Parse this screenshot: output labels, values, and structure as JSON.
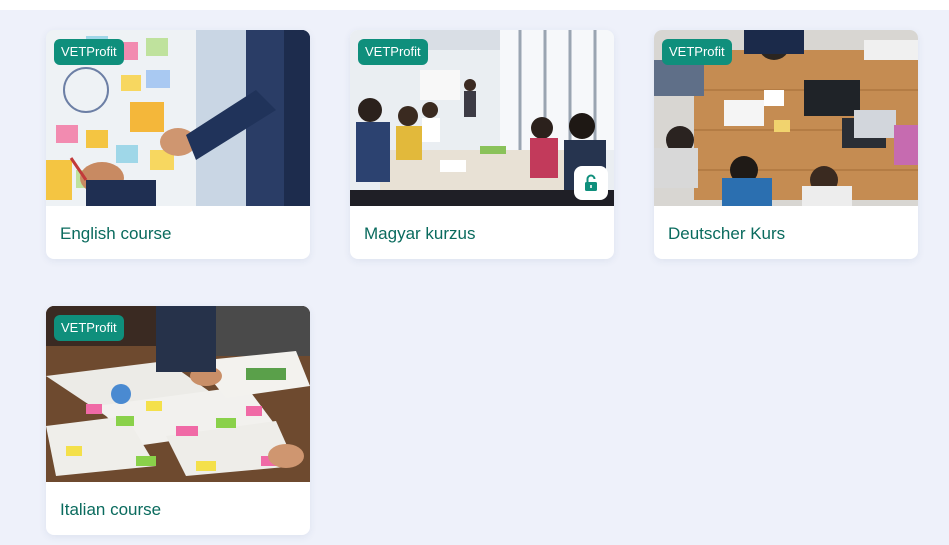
{
  "colors": {
    "badge_bg": "#0f8f7c",
    "title_text": "#0a6b5e",
    "page_bg": "#eef1fa",
    "card_bg": "#ffffff"
  },
  "courses": [
    {
      "title": "English course",
      "badge": "VETProfit",
      "image": "sticky-notes-on-glass-wall",
      "locked": false
    },
    {
      "title": "Magyar kurzus",
      "badge": "VETProfit",
      "image": "meeting-room-presentation",
      "locked": true,
      "lock_icon": "unlock-icon"
    },
    {
      "title": "Deutscher Kurs",
      "badge": "VETProfit",
      "image": "team-around-wooden-table",
      "locked": false
    },
    {
      "title": "Italian course",
      "badge": "VETProfit",
      "image": "papers-and-sticky-notes-on-table",
      "locked": false
    }
  ]
}
